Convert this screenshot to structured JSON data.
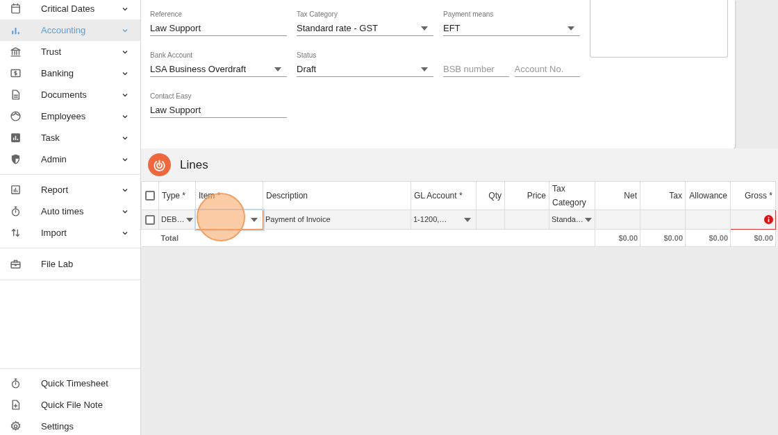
{
  "sidebar": {
    "sections": [
      {
        "items": [
          {
            "label": "Critical Dates",
            "expandable": true,
            "selected": false
          },
          {
            "label": "Accounting",
            "expandable": true,
            "selected": true
          },
          {
            "label": "Trust",
            "expandable": true,
            "selected": false
          },
          {
            "label": "Banking",
            "expandable": true,
            "selected": false
          },
          {
            "label": "Documents",
            "expandable": true,
            "selected": false
          },
          {
            "label": "Employees",
            "expandable": true,
            "selected": false
          },
          {
            "label": "Task",
            "expandable": true,
            "selected": false
          },
          {
            "label": "Admin",
            "expandable": true,
            "selected": false
          }
        ]
      },
      {
        "items": [
          {
            "label": "Report",
            "expandable": true,
            "selected": false
          },
          {
            "label": "Auto times",
            "expandable": true,
            "selected": false
          },
          {
            "label": "Import",
            "expandable": true,
            "selected": false
          }
        ]
      },
      {
        "items": [
          {
            "label": "File Lab",
            "expandable": false,
            "selected": false
          }
        ]
      },
      {
        "items": [
          {
            "label": "Quick Timesheet",
            "expandable": false,
            "selected": false
          },
          {
            "label": "Quick File Note",
            "expandable": false,
            "selected": false
          },
          {
            "label": "Settings",
            "expandable": false,
            "selected": false
          }
        ]
      }
    ]
  },
  "form": {
    "rows": [
      [
        {
          "kind": "text",
          "label": "Reference",
          "value": "Law Support"
        },
        {
          "kind": "select",
          "label": "Tax Category",
          "value": "Standard rate - GST"
        },
        {
          "kind": "select",
          "label": "Payment means",
          "value": "EFT"
        }
      ],
      [
        {
          "kind": "select",
          "label": "Bank Account",
          "value": "LSA Business Overdraft"
        },
        {
          "kind": "select",
          "label": "Status",
          "value": "Draft"
        },
        {
          "kind": "pair",
          "fields": [
            {
              "placeholder": "BSB number"
            },
            {
              "placeholder": "Account No."
            }
          ]
        }
      ],
      [
        {
          "kind": "text",
          "label": "Contact Easy",
          "value": "Law Support"
        }
      ]
    ]
  },
  "lines": {
    "title": "Lines",
    "table": {
      "header_checkbox": {
        "checked": false
      },
      "columns": [
        {
          "label": "Type *",
          "kind": "text"
        },
        {
          "label": "Item *",
          "kind": "text"
        },
        {
          "label": "Description",
          "kind": "text"
        },
        {
          "label": "GL Account *",
          "kind": "text"
        },
        {
          "label": "Qty",
          "kind": "number"
        },
        {
          "label": "Price",
          "kind": "number"
        },
        {
          "label": "Tax Category",
          "kind": "text"
        },
        {
          "label": "Net",
          "kind": "number"
        },
        {
          "label": "Tax",
          "kind": "number"
        },
        {
          "label": "Allowance",
          "kind": "number"
        },
        {
          "label": "Gross *",
          "kind": "number"
        }
      ],
      "rows": [
        {
          "checked": false,
          "cells": [
            {
              "kind": "select",
              "text": "DEB…",
              "focused": false,
              "error": false
            },
            {
              "kind": "select",
              "focused": true,
              "error": false
            },
            {
              "kind": "input",
              "text": "Payment of Invoice",
              "focused": false,
              "error": false
            },
            {
              "kind": "select",
              "text": "1-1200,…",
              "focused": false,
              "error": false
            },
            {
              "kind": "input",
              "focused": false,
              "error": false
            },
            {
              "kind": "input",
              "focused": false,
              "error": false
            },
            {
              "kind": "select",
              "text": "Standa…",
              "focused": false,
              "error": false
            },
            {
              "kind": "input",
              "focused": false,
              "error": false
            },
            {
              "kind": "input",
              "focused": false,
              "error": false
            },
            {
              "kind": "input",
              "focused": false,
              "error": false
            },
            {
              "kind": "input",
              "focused": false,
              "error": true
            }
          ]
        }
      ],
      "totals": {
        "label": "Total",
        "values": [
          "$0.00",
          "$0.00",
          "$0.00",
          "$0.00"
        ]
      }
    }
  }
}
